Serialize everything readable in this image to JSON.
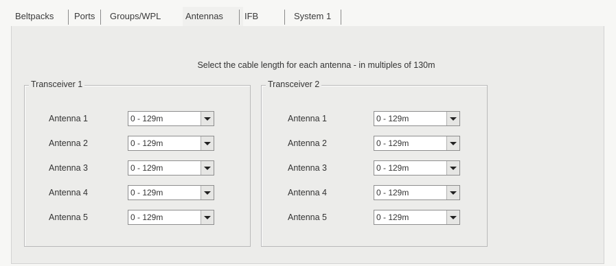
{
  "tabs": [
    "Beltpacks",
    "Ports",
    "Groups/WPL",
    "Antennas",
    "IFB",
    "System 1"
  ],
  "active_tab": "Antennas",
  "instruction": "Select the cable length for each antenna - in multiples of 130m",
  "transceivers": [
    {
      "title": "Transceiver 1",
      "antennas": [
        {
          "label": "Antenna 1",
          "value": "0 - 129m"
        },
        {
          "label": "Antenna 2",
          "value": "0 - 129m"
        },
        {
          "label": "Antenna 3",
          "value": "0 - 129m"
        },
        {
          "label": "Antenna 4",
          "value": "0 - 129m"
        },
        {
          "label": "Antenna 5",
          "value": "0 - 129m"
        }
      ]
    },
    {
      "title": "Transceiver 2",
      "antennas": [
        {
          "label": "Antenna 1",
          "value": "0 - 129m"
        },
        {
          "label": "Antenna 2",
          "value": "0 - 129m"
        },
        {
          "label": "Antenna 3",
          "value": "0 - 129m"
        },
        {
          "label": "Antenna 4",
          "value": "0 - 129m"
        },
        {
          "label": "Antenna 5",
          "value": "0 - 129m"
        }
      ]
    }
  ]
}
